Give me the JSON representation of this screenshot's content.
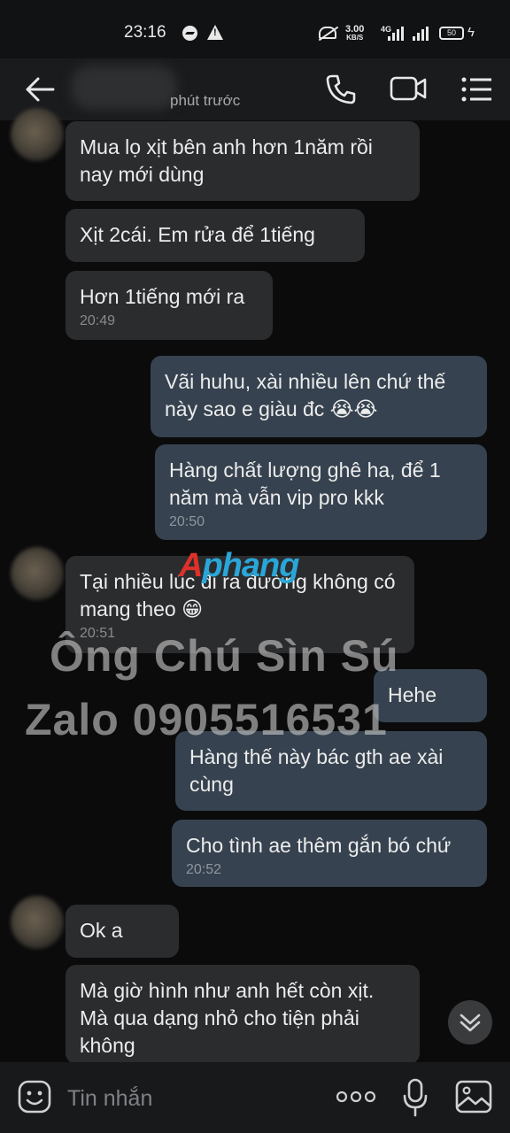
{
  "status_bar": {
    "time": "23:16",
    "net_speed_value": "3.00",
    "net_speed_unit": "KB/S",
    "network_type": "4G",
    "battery": "50"
  },
  "header": {
    "subtitle": "phút trước"
  },
  "messages": [
    {
      "dir": "in",
      "text": "Mua lọ xịt bên anh hơn 1năm rồi nay mới dùng",
      "time": ""
    },
    {
      "dir": "in",
      "text": "Xịt 2cái.  Em rửa để 1tiếng",
      "time": ""
    },
    {
      "dir": "in",
      "text": "Hơn 1tiếng mới ra",
      "time": "20:49"
    },
    {
      "dir": "out",
      "text": "Vãi huhu, xài nhiều lên chứ thế này sao e giàu đc 😭😭",
      "time": ""
    },
    {
      "dir": "out",
      "text": "Hàng chất lượng ghê ha, để 1 năm mà vẫn vip pro kkk",
      "time": "20:50"
    },
    {
      "dir": "in",
      "text": "Tại nhiều lúc đi ra đường không có mang theo 😁",
      "time": "20:51"
    },
    {
      "dir": "out",
      "text": "Hehe",
      "time": ""
    },
    {
      "dir": "out",
      "text": "Hàng thế này bác gth ae xài cùng",
      "time": ""
    },
    {
      "dir": "out",
      "text": "Cho tình ae thêm gắn bó chứ",
      "time": "20:52"
    },
    {
      "dir": "in",
      "text": "Ok a",
      "time": ""
    },
    {
      "dir": "in",
      "text": "Mà giờ hình như anh hết còn xịt. Mà qua dạng nhỏ cho tiện phải không",
      "time": ""
    }
  ],
  "watermark": {
    "logo_part1": "A",
    "logo_part2": "phang",
    "line1": "Ông Chú Sìn Sú",
    "line2": "Zalo 0905516531"
  },
  "composer": {
    "placeholder": "Tin nhắn"
  },
  "icons": {
    "back": "arrow-left-icon",
    "call": "phone-icon",
    "video": "video-camera-icon",
    "menu": "list-menu-icon",
    "emoji": "emoji-icon",
    "more": "more-dots-icon",
    "mic": "microphone-icon",
    "image": "image-icon",
    "scroll": "chevron-double-down-icon"
  }
}
